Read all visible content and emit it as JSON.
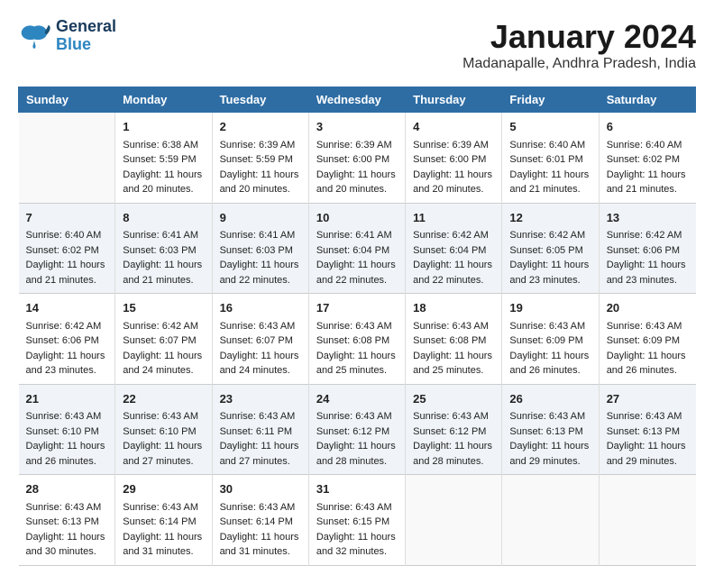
{
  "header": {
    "logo_line1": "General",
    "logo_line2": "Blue",
    "month": "January 2024",
    "location": "Madanapalle, Andhra Pradesh, India"
  },
  "weekdays": [
    "Sunday",
    "Monday",
    "Tuesday",
    "Wednesday",
    "Thursday",
    "Friday",
    "Saturday"
  ],
  "weeks": [
    [
      {
        "day": "",
        "content": ""
      },
      {
        "day": "1",
        "content": "Sunrise: 6:38 AM\nSunset: 5:59 PM\nDaylight: 11 hours and 20 minutes."
      },
      {
        "day": "2",
        "content": "Sunrise: 6:39 AM\nSunset: 5:59 PM\nDaylight: 11 hours and 20 minutes."
      },
      {
        "day": "3",
        "content": "Sunrise: 6:39 AM\nSunset: 6:00 PM\nDaylight: 11 hours and 20 minutes."
      },
      {
        "day": "4",
        "content": "Sunrise: 6:39 AM\nSunset: 6:00 PM\nDaylight: 11 hours and 20 minutes."
      },
      {
        "day": "5",
        "content": "Sunrise: 6:40 AM\nSunset: 6:01 PM\nDaylight: 11 hours and 21 minutes."
      },
      {
        "day": "6",
        "content": "Sunrise: 6:40 AM\nSunset: 6:02 PM\nDaylight: 11 hours and 21 minutes."
      }
    ],
    [
      {
        "day": "7",
        "content": "Sunrise: 6:40 AM\nSunset: 6:02 PM\nDaylight: 11 hours and 21 minutes."
      },
      {
        "day": "8",
        "content": "Sunrise: 6:41 AM\nSunset: 6:03 PM\nDaylight: 11 hours and 21 minutes."
      },
      {
        "day": "9",
        "content": "Sunrise: 6:41 AM\nSunset: 6:03 PM\nDaylight: 11 hours and 22 minutes."
      },
      {
        "day": "10",
        "content": "Sunrise: 6:41 AM\nSunset: 6:04 PM\nDaylight: 11 hours and 22 minutes."
      },
      {
        "day": "11",
        "content": "Sunrise: 6:42 AM\nSunset: 6:04 PM\nDaylight: 11 hours and 22 minutes."
      },
      {
        "day": "12",
        "content": "Sunrise: 6:42 AM\nSunset: 6:05 PM\nDaylight: 11 hours and 23 minutes."
      },
      {
        "day": "13",
        "content": "Sunrise: 6:42 AM\nSunset: 6:06 PM\nDaylight: 11 hours and 23 minutes."
      }
    ],
    [
      {
        "day": "14",
        "content": "Sunrise: 6:42 AM\nSunset: 6:06 PM\nDaylight: 11 hours and 23 minutes."
      },
      {
        "day": "15",
        "content": "Sunrise: 6:42 AM\nSunset: 6:07 PM\nDaylight: 11 hours and 24 minutes."
      },
      {
        "day": "16",
        "content": "Sunrise: 6:43 AM\nSunset: 6:07 PM\nDaylight: 11 hours and 24 minutes."
      },
      {
        "day": "17",
        "content": "Sunrise: 6:43 AM\nSunset: 6:08 PM\nDaylight: 11 hours and 25 minutes."
      },
      {
        "day": "18",
        "content": "Sunrise: 6:43 AM\nSunset: 6:08 PM\nDaylight: 11 hours and 25 minutes."
      },
      {
        "day": "19",
        "content": "Sunrise: 6:43 AM\nSunset: 6:09 PM\nDaylight: 11 hours and 26 minutes."
      },
      {
        "day": "20",
        "content": "Sunrise: 6:43 AM\nSunset: 6:09 PM\nDaylight: 11 hours and 26 minutes."
      }
    ],
    [
      {
        "day": "21",
        "content": "Sunrise: 6:43 AM\nSunset: 6:10 PM\nDaylight: 11 hours and 26 minutes."
      },
      {
        "day": "22",
        "content": "Sunrise: 6:43 AM\nSunset: 6:10 PM\nDaylight: 11 hours and 27 minutes."
      },
      {
        "day": "23",
        "content": "Sunrise: 6:43 AM\nSunset: 6:11 PM\nDaylight: 11 hours and 27 minutes."
      },
      {
        "day": "24",
        "content": "Sunrise: 6:43 AM\nSunset: 6:12 PM\nDaylight: 11 hours and 28 minutes."
      },
      {
        "day": "25",
        "content": "Sunrise: 6:43 AM\nSunset: 6:12 PM\nDaylight: 11 hours and 28 minutes."
      },
      {
        "day": "26",
        "content": "Sunrise: 6:43 AM\nSunset: 6:13 PM\nDaylight: 11 hours and 29 minutes."
      },
      {
        "day": "27",
        "content": "Sunrise: 6:43 AM\nSunset: 6:13 PM\nDaylight: 11 hours and 29 minutes."
      }
    ],
    [
      {
        "day": "28",
        "content": "Sunrise: 6:43 AM\nSunset: 6:13 PM\nDaylight: 11 hours and 30 minutes."
      },
      {
        "day": "29",
        "content": "Sunrise: 6:43 AM\nSunset: 6:14 PM\nDaylight: 11 hours and 31 minutes."
      },
      {
        "day": "30",
        "content": "Sunrise: 6:43 AM\nSunset: 6:14 PM\nDaylight: 11 hours and 31 minutes."
      },
      {
        "day": "31",
        "content": "Sunrise: 6:43 AM\nSunset: 6:15 PM\nDaylight: 11 hours and 32 minutes."
      },
      {
        "day": "",
        "content": ""
      },
      {
        "day": "",
        "content": ""
      },
      {
        "day": "",
        "content": ""
      }
    ]
  ]
}
